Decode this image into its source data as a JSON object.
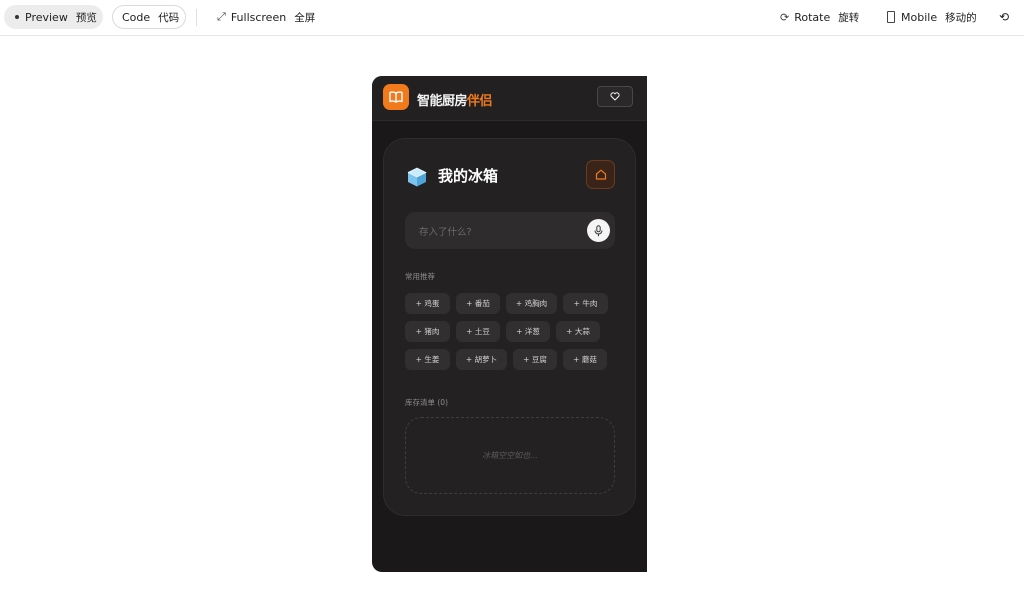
{
  "toolbar": {
    "preview_label": "Preview",
    "preview_label_zh": "预览",
    "code_label": "Code",
    "code_label_zh": "代码",
    "fullscreen_label": "Fullscreen",
    "fullscreen_label_zh": "全屏",
    "rotate_label": "Rotate",
    "rotate_label_zh": "旋转",
    "mobile_label": "Mobile",
    "mobile_label_zh": "移动的",
    "refresh_icon": "⟲"
  },
  "app": {
    "title_main": "智能厨房",
    "title_accent": "伴侣",
    "accent_color": "#f07a1c",
    "logo_icon": "book-icon",
    "favorite_icon": "heart-icon"
  },
  "fridge": {
    "icon": "ice-cube-icon",
    "title": "我的冰箱",
    "home_icon": "home-icon",
    "search_placeholder": "存入了什么?",
    "mic_icon": "microphone-icon",
    "suggest_label": "常用推荐",
    "suggestions": [
      [
        "+ 鸡蛋",
        "+ 番茄",
        "+ 鸡胸肉",
        "+ 牛肉"
      ],
      [
        "+ 猪肉",
        "+ 土豆",
        "+ 洋葱",
        "+ 大蒜"
      ],
      [
        "+ 生姜",
        "+ 胡萝卜",
        "+ 豆腐",
        "+ 蘑菇"
      ]
    ],
    "inventory_label": "库存清单 (0)",
    "empty_text": "冰箱空空如也..."
  }
}
